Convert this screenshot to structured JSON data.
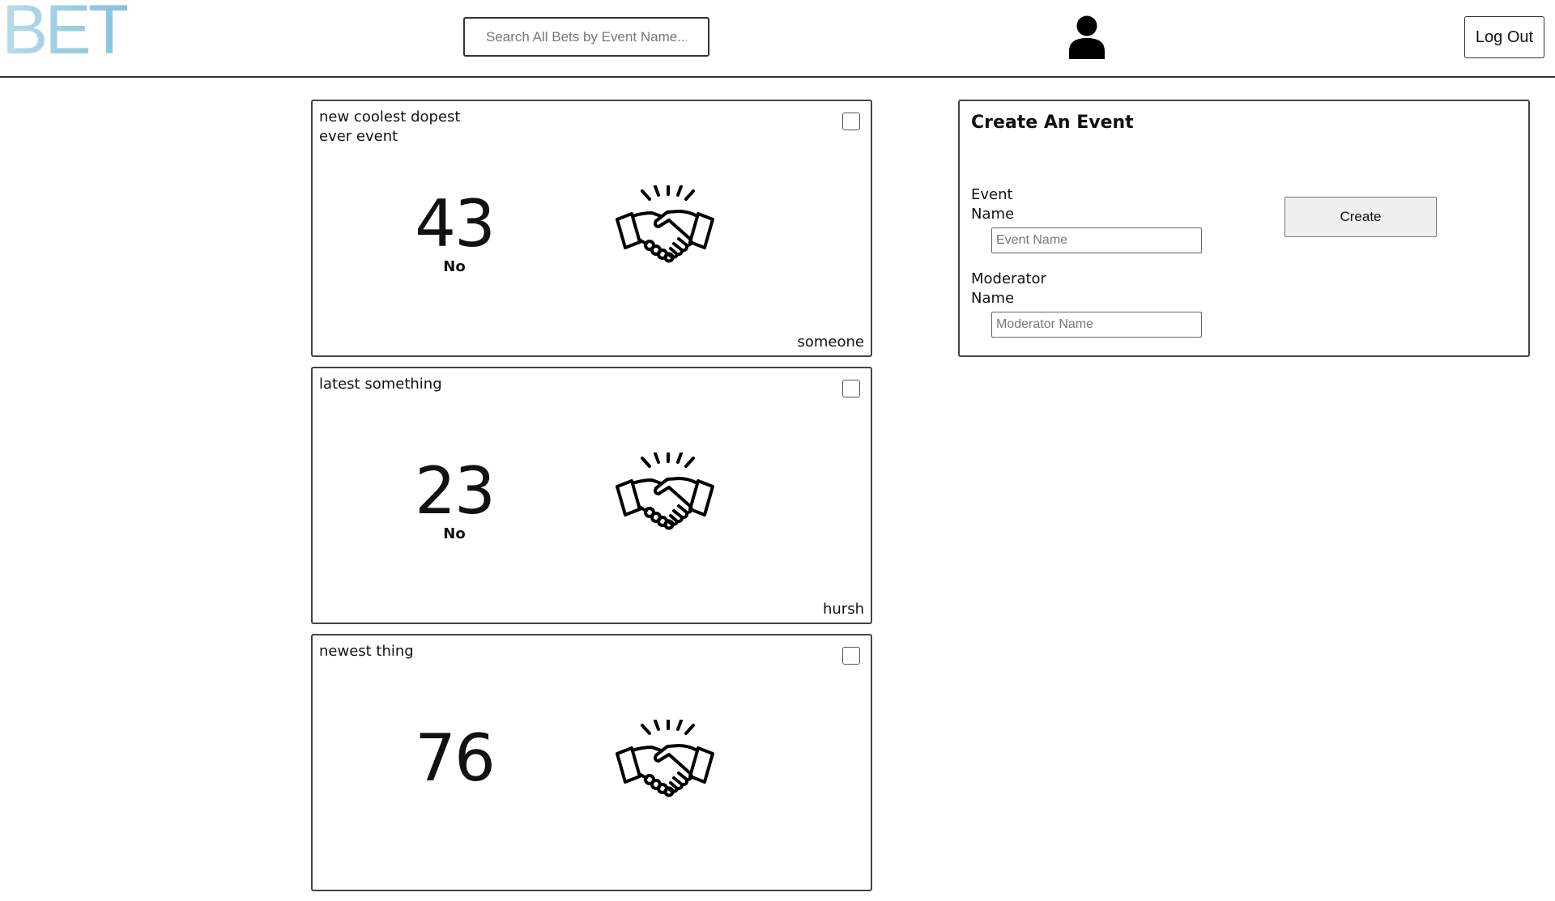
{
  "app": {
    "logo": "BET"
  },
  "header": {
    "search_placeholder": "Search All Bets by Event Name...",
    "avatar_icon": "user-icon",
    "logout_label": "Log Out"
  },
  "bets": [
    {
      "title": "new coolest dopest ever event",
      "count": "43",
      "answer": "No",
      "author": "someone",
      "icon": "handshake-icon"
    },
    {
      "title": "latest something",
      "count": "23",
      "answer": "No",
      "author": "hursh",
      "icon": "handshake-icon"
    },
    {
      "title": "newest thing",
      "count": "76",
      "answer": "",
      "author": "",
      "icon": "handshake-icon"
    }
  ],
  "create_event": {
    "title": "Create An Event",
    "event_name_label": "Event Name",
    "event_name_placeholder": "Event Name",
    "moderator_name_label": "Moderator Name",
    "moderator_name_placeholder": "Moderator Name",
    "create_label": "Create"
  },
  "colors": {
    "logo_gradient": [
      "#b8dcea",
      "#86c3dc"
    ],
    "border": "#444444",
    "button_bg": "#efefef"
  }
}
